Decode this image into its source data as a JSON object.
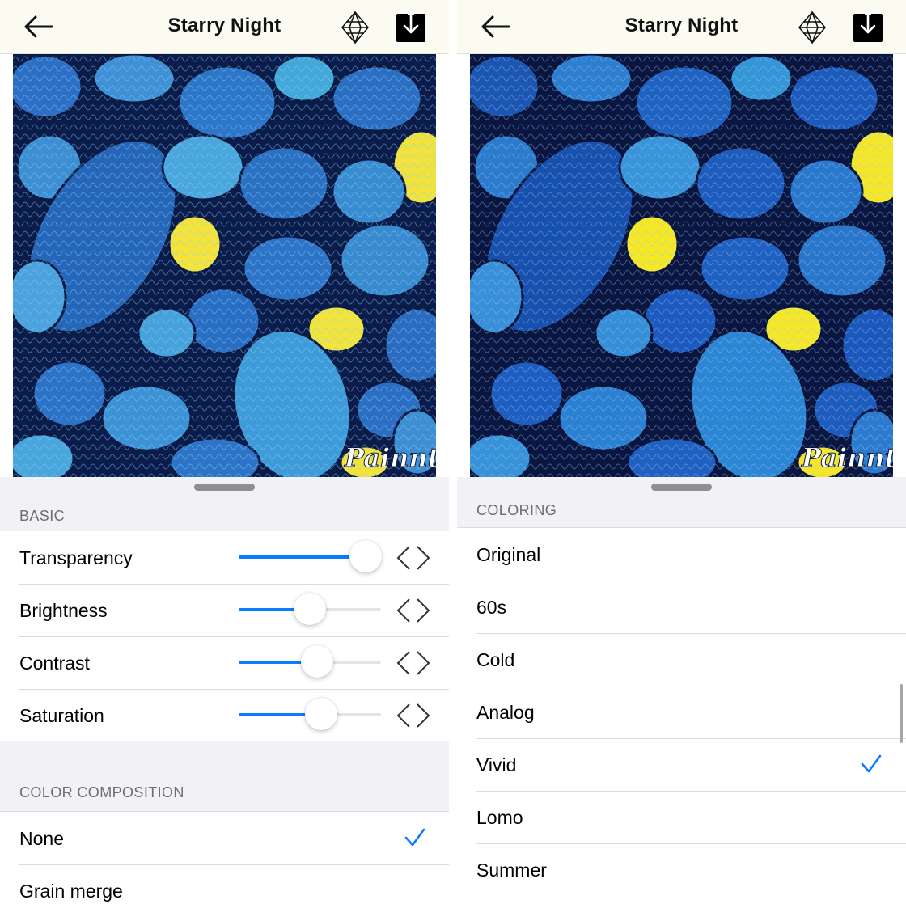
{
  "colors": {
    "accent": "#0a7cff",
    "header_bg": "#fbfbf1",
    "sheet_bg": "#f1f1f6",
    "rock_blue": "#1e5fb0",
    "rock_yellow": "#f2ef3a"
  },
  "left": {
    "header": {
      "title": "Starry Night",
      "back_icon": "arrow-left-icon",
      "premium_icon": "diamond-icon",
      "download_icon": "download-icon"
    },
    "image": {
      "description_icon": "image",
      "watermark": "Painnt"
    },
    "basic": {
      "header": "BASIC",
      "sliders": [
        {
          "label": "Transparency",
          "value": 0.89
        },
        {
          "label": "Brightness",
          "value": 0.5
        },
        {
          "label": "Contrast",
          "value": 0.55
        },
        {
          "label": "Saturation",
          "value": 0.58
        }
      ]
    },
    "color_composition": {
      "header": "COLOR COMPOSITION",
      "items": [
        {
          "label": "None",
          "selected": true
        },
        {
          "label": "Grain merge",
          "selected": false
        }
      ]
    }
  },
  "right": {
    "header": {
      "title": "Starry Night",
      "back_icon": "arrow-left-icon",
      "premium_icon": "diamond-icon",
      "download_icon": "download-icon"
    },
    "image": {
      "watermark": "Painnt"
    },
    "coloring": {
      "header": "COLORING",
      "items": [
        {
          "label": "Original",
          "selected": false
        },
        {
          "label": "60s",
          "selected": false
        },
        {
          "label": "Cold",
          "selected": false
        },
        {
          "label": "Analog",
          "selected": false
        },
        {
          "label": "Vivid",
          "selected": true
        },
        {
          "label": "Lomo",
          "selected": false
        },
        {
          "label": "Summer",
          "selected": false
        }
      ]
    }
  }
}
